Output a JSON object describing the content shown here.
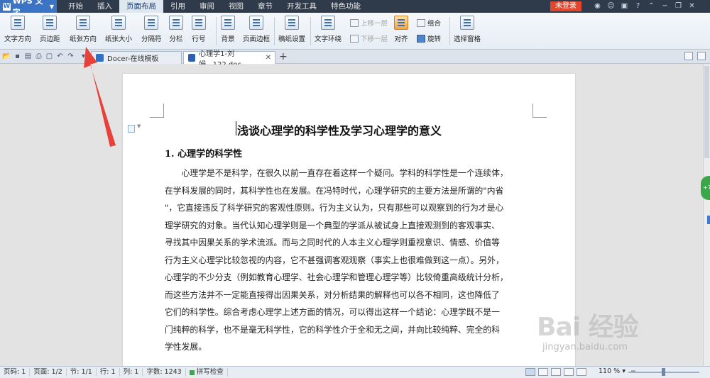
{
  "app": {
    "name": "WPS 文字",
    "login": "未登录"
  },
  "menu": [
    "开始",
    "插入",
    "页面布局",
    "引用",
    "审阅",
    "视图",
    "章节",
    "开发工具",
    "特色功能"
  ],
  "ribbon": {
    "text_direction": "文字方向",
    "margins": "页边距",
    "orientation": "纸张方向",
    "size": "纸张大小",
    "breaks": "分隔符",
    "columns": "分栏",
    "line_numbers": "行号",
    "background": "背景",
    "page_border": "页面边框",
    "manuscript": "稿纸设置",
    "wrap": "文字环绕",
    "bring_forward": "上移一层",
    "send_backward": "下移一层",
    "align": "对齐",
    "group": "组合",
    "rotate": "旋转",
    "selection_pane": "选择窗格"
  },
  "tabs": [
    {
      "label": "Docer-在线模板"
    },
    {
      "label": "心理学1-刘娟...122.doc"
    }
  ],
  "doc": {
    "title": "浅谈心理学的科学性及学习心理学的意义",
    "heading": "1. 心理学的科学性",
    "lines": [
      "　　心理学是不是科学，在很久以前一直存在着这样一个疑问。学科的科学性是一个连续体，",
      "在学科发展的同时，其科学性也在发展。在冯特时代，心理学研究的主要方法是所谓的\"内省",
      "\"，它直接违反了科学研究的客观性原则。行为主义认为，只有那些可以观察到的行为才是心",
      "理学研究的对象。当代认知心理学则是一个典型的学派从被试身上直接观测到的客观事实、",
      "寻找其中因果关系的学术流派。而与之同时代的人本主义心理学则重视意识、情感、价值等",
      "行为主义心理学比较忽视的内容，它不甚强调客观观察（事实上也很难做到这一点）。另外，",
      "心理学的不少分支（例如教育心理学、社会心理学和管理心理学等）比较倚重高级统计分析，",
      "而这些方法并不一定能直接得出因果关系，对分析结果的解释也可以各不相同，这也降低了",
      "它们的科学性。综合考虑心理学上述方面的情况，可以得出这样一个结论：心理学既不是一",
      "门纯粹的科学，也不是毫无科学性，它的科学性介于全和无之间，并向比较纯粹、完全的科",
      "学性发展。"
    ]
  },
  "sidebar_badge": "+7",
  "watermark": {
    "main": "Bai 经验",
    "sub": "jingyan.baidu.com"
  },
  "status": {
    "page_no": "页码: 1",
    "pages": "页面: 1/2",
    "section": "节: 1/1",
    "row": "行: 1",
    "col": "列: 1",
    "words": "字数: 1243",
    "spell": "拼写检查",
    "zoom": "110 %"
  },
  "colors": {
    "menubar": "#2f3a4a",
    "accent": "#3b74c4",
    "login": "#e2472b",
    "arrow": "#e8413a"
  }
}
